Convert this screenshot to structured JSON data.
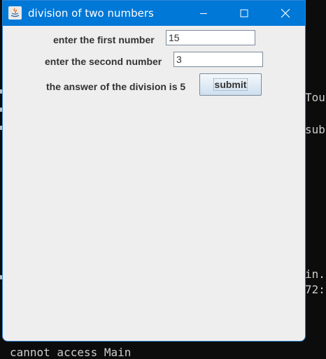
{
  "window": {
    "title": "division of two numbers"
  },
  "form": {
    "first_label": "enter the first number",
    "first_value": "15",
    "second_label": "enter the second number",
    "second_value": "3",
    "answer_label": "the answer of the division is 5",
    "submit_label": "submit"
  },
  "terminal": {
    "frag_1": "Tou",
    "frag_2": "sub",
    "frag_3": "in.",
    "frag_4": "72:",
    "frag_5": "cannot access Main"
  },
  "colors": {
    "titlebar": "#0078d7",
    "window_bg": "#eeeeee",
    "terminal_bg": "#0c0c0c"
  }
}
